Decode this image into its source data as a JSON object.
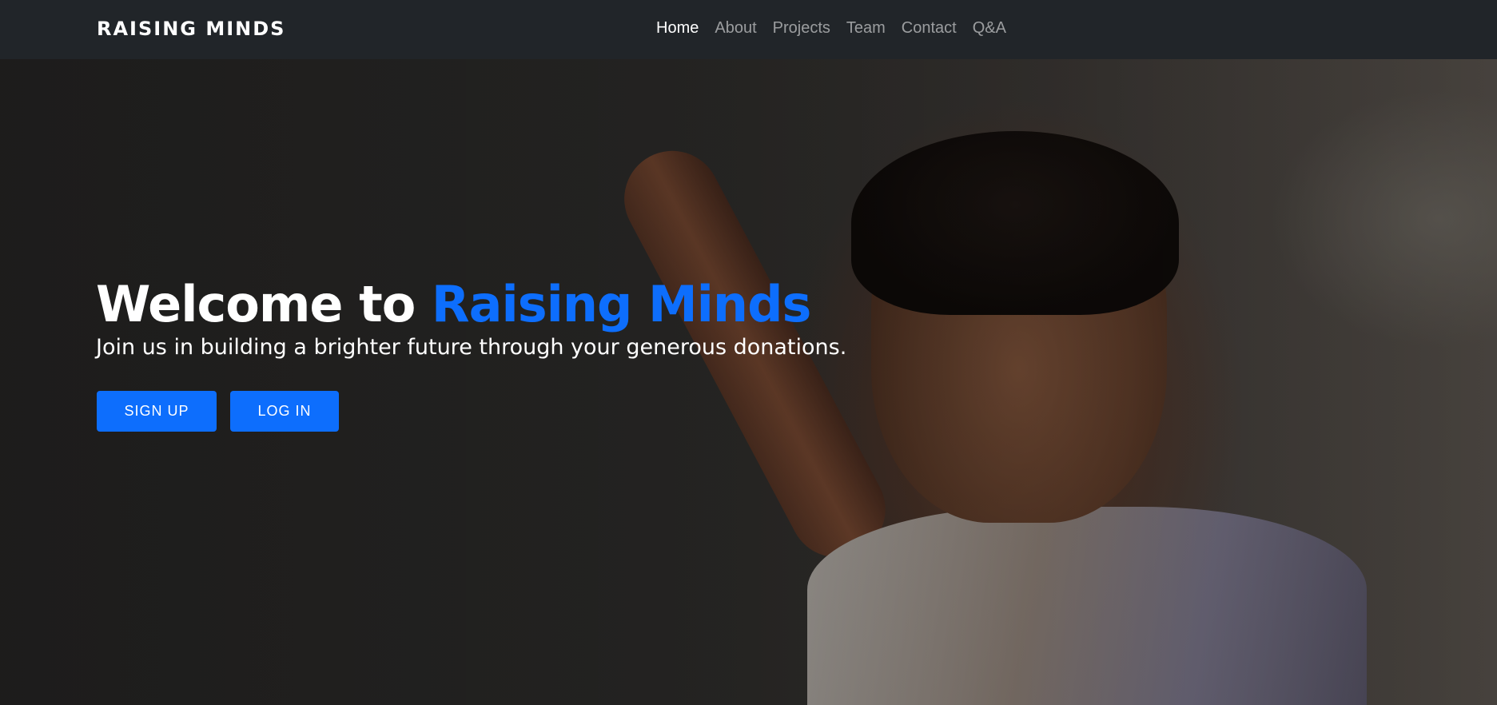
{
  "brand": "RAISING MINDS",
  "nav": {
    "items": [
      {
        "label": "Home",
        "active": true
      },
      {
        "label": "About",
        "active": false
      },
      {
        "label": "Projects",
        "active": false
      },
      {
        "label": "Team",
        "active": false
      },
      {
        "label": "Contact",
        "active": false
      },
      {
        "label": "Q&A",
        "active": false
      }
    ]
  },
  "hero": {
    "title_prefix": "Welcome to",
    "title_accent": "Raising Minds",
    "subtitle": "Join us in building a brighter future through your generous donations.",
    "signup_label": "SIGN UP",
    "login_label": "LOG IN"
  },
  "colors": {
    "navbar_bg": "#212529",
    "accent": "#0d6efd",
    "text": "#ffffff",
    "nav_inactive": "rgba(255,255,255,0.55)"
  }
}
